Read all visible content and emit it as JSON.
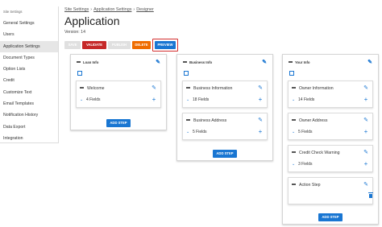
{
  "sidebar": {
    "title": "Site Settings",
    "items": [
      {
        "label": "General Settings"
      },
      {
        "label": "Users"
      },
      {
        "label": "Application Settings",
        "active": true
      },
      {
        "label": "Document Types"
      },
      {
        "label": "Option Lists"
      },
      {
        "label": "Credit"
      },
      {
        "label": "Customize Text"
      },
      {
        "label": "Email Templates"
      },
      {
        "label": "Notification History"
      },
      {
        "label": "Data Export"
      },
      {
        "label": "Integration"
      }
    ]
  },
  "breadcrumb": [
    "Site Settings",
    "Application Settings",
    "Designer"
  ],
  "breadcrumb_sep": "›",
  "page": {
    "title": "Application",
    "version": "Version: 14"
  },
  "toolbar": {
    "save": "SAVE",
    "validate": "VALIDATE",
    "publish": "PUBLISH",
    "delete": "DELETE",
    "preview": "PREVIEW"
  },
  "colors": {
    "primary": "#1976d2",
    "validate": "#c62828",
    "delete": "#ef6c00",
    "disabled": "#e0e0e0",
    "highlight": "#d32f2f"
  },
  "steps": [
    {
      "name": "Loan Info",
      "cards": [
        {
          "title": "Welcome",
          "fields": "4 Fields"
        }
      ],
      "add_label": "ADD STEP"
    },
    {
      "name": "Business Info",
      "cards": [
        {
          "title": "Business Information",
          "fields": "18 Fields"
        },
        {
          "title": "Business Address",
          "fields": "5 Fields"
        }
      ],
      "add_label": "ADD STEP"
    },
    {
      "name": "Your Info",
      "cards": [
        {
          "title": "Owner Information",
          "fields": "14 Fields"
        },
        {
          "title": "Owner Address",
          "fields": "5 Fields"
        },
        {
          "title": "Credit Check Warning",
          "fields": "3 Fields"
        },
        {
          "title": "Action Step",
          "fields": ""
        }
      ],
      "add_label": "ADD STEP"
    }
  ],
  "icons": {
    "edit": "pencil-icon",
    "drag": "drag-handle-icon",
    "expand": "expand-icon",
    "chevron": "chevron-down-icon",
    "add": "plus-icon",
    "delete": "trash-icon"
  }
}
